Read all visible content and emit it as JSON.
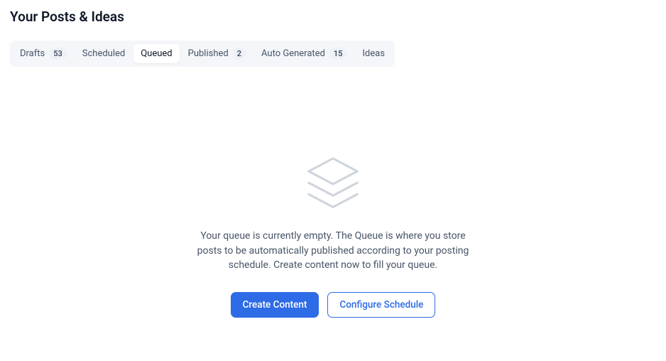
{
  "header": {
    "title": "Your Posts & Ideas"
  },
  "tabs": {
    "items": [
      {
        "label": "Drafts",
        "badge": "53"
      },
      {
        "label": "Scheduled",
        "badge": ""
      },
      {
        "label": "Queued",
        "badge": ""
      },
      {
        "label": "Published",
        "badge": "2"
      },
      {
        "label": "Auto Generated",
        "badge": "15"
      },
      {
        "label": "Ideas",
        "badge": ""
      }
    ],
    "active_index": 2
  },
  "empty_state": {
    "icon": "layers-icon",
    "message": "Your queue is currently empty. The Queue is where you store posts to be automatically published according to your posting schedule. Create content now to fill your queue.",
    "primary_button": "Create Content",
    "secondary_button": "Configure Schedule"
  }
}
